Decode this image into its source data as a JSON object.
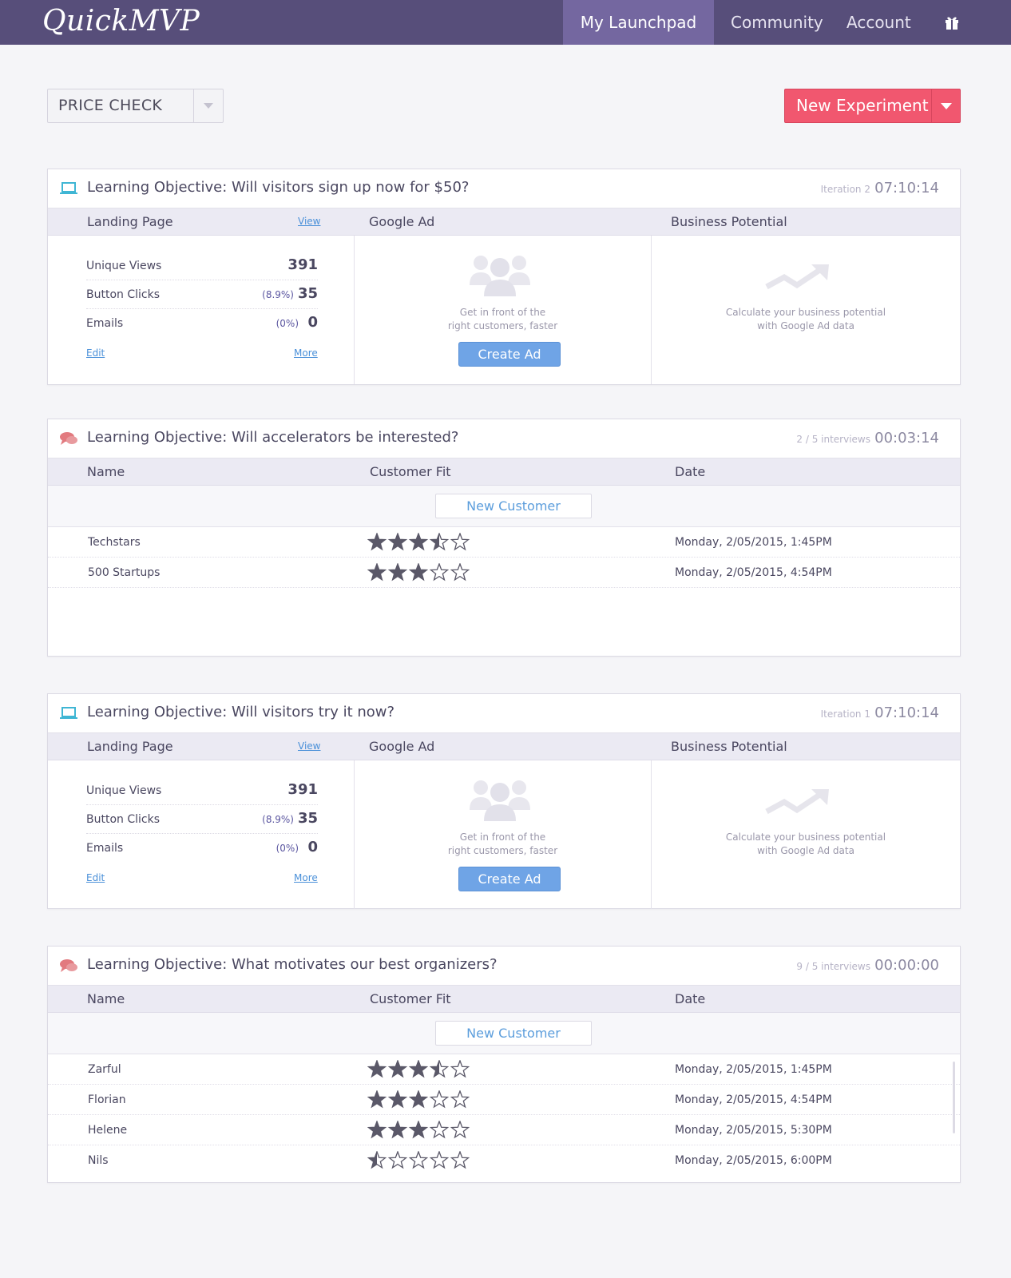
{
  "app": {
    "logo": "QuickMVP"
  },
  "nav": {
    "items": [
      {
        "label": "My Launchpad",
        "active": true
      },
      {
        "label": "Community",
        "active": false
      },
      {
        "label": "Account",
        "active": false
      }
    ],
    "gift_icon": "gift-icon"
  },
  "selector": {
    "value": "PRICE CHECK"
  },
  "new_experiment": {
    "label": "New Experiment"
  },
  "colors": {
    "nav": "#574e7a",
    "nav_active": "#7467a0",
    "primary": "#f1576f",
    "link": "#4a90d9",
    "ad_button": "#6fa4e6"
  },
  "cards": [
    {
      "type": "landing",
      "title": "Learning Objective: Will visitors sign up now for $50?",
      "meta": "Iteration 2",
      "time": "07:10:14",
      "columns": {
        "landing": "Landing Page",
        "view": "View",
        "google": "Google Ad",
        "business": "Business Potential"
      },
      "stats": [
        {
          "label": "Unique Views",
          "pct": "",
          "value": "391"
        },
        {
          "label": "Button Clicks",
          "pct": "(8.9%)",
          "value": "35"
        },
        {
          "label": "Emails",
          "pct": "(0%)",
          "value": "0"
        }
      ],
      "edit": "Edit",
      "more": "More",
      "ad_text_1": "Get in front of the",
      "ad_text_2": "right customers, faster",
      "create_ad": "Create Ad",
      "biz_text_1": "Calculate your business potential",
      "biz_text_2": "with Google Ad data"
    },
    {
      "type": "interviews",
      "title": "Learning Objective: Will accelerators be interested?",
      "meta": "2 / 5 interviews",
      "time": "00:03:14",
      "columns": {
        "name": "Name",
        "fit": "Customer Fit",
        "date": "Date"
      },
      "new_customer": "New Customer",
      "rows": [
        {
          "name": "Techstars",
          "rating": 3.5,
          "date": "Monday, 2/05/2015, 1:45PM"
        },
        {
          "name": "500 Startups",
          "rating": 3,
          "date": "Monday, 2/05/2015, 4:54PM"
        }
      ]
    },
    {
      "type": "landing",
      "title": "Learning Objective: Will visitors try it now?",
      "meta": "Iteration 1",
      "time": "07:10:14",
      "columns": {
        "landing": "Landing Page",
        "view": "View",
        "google": "Google Ad",
        "business": "Business Potential"
      },
      "stats": [
        {
          "label": "Unique Views",
          "pct": "",
          "value": "391"
        },
        {
          "label": "Button Clicks",
          "pct": "(8.9%)",
          "value": "35"
        },
        {
          "label": "Emails",
          "pct": "(0%)",
          "value": "0"
        }
      ],
      "edit": "Edit",
      "more": "More",
      "ad_text_1": "Get in front of the",
      "ad_text_2": "right customers, faster",
      "create_ad": "Create Ad",
      "biz_text_1": "Calculate your business potential",
      "biz_text_2": "with Google Ad data"
    },
    {
      "type": "interviews",
      "title": "Learning Objective: What motivates our best organizers?",
      "meta": "9 / 5 interviews",
      "time": "00:00:00",
      "columns": {
        "name": "Name",
        "fit": "Customer Fit",
        "date": "Date"
      },
      "new_customer": "New Customer",
      "rows": [
        {
          "name": "Zarful",
          "rating": 3.5,
          "date": "Monday, 2/05/2015, 1:45PM"
        },
        {
          "name": "Florian",
          "rating": 3,
          "date": "Monday, 2/05/2015, 4:54PM"
        },
        {
          "name": "Helene",
          "rating": 3,
          "date": "Monday, 2/05/2015, 5:30PM"
        },
        {
          "name": "Nils",
          "rating": 0.5,
          "date": "Monday, 2/05/2015, 6:00PM"
        }
      ]
    }
  ]
}
